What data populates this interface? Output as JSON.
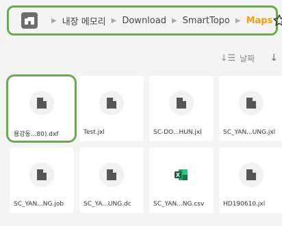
{
  "breadcrumb": {
    "items": [
      {
        "label": "내장 메모리"
      },
      {
        "label": "Download"
      },
      {
        "label": "SmartTopo"
      },
      {
        "label": "Maps"
      }
    ],
    "separator": "▶"
  },
  "sort": {
    "label": "날짜"
  },
  "files": [
    {
      "name": "용강동...80).dxf",
      "type": "generic"
    },
    {
      "name": "Test.jxl",
      "type": "generic"
    },
    {
      "name": "SC-DO...HUN.jxl",
      "type": "generic"
    },
    {
      "name": "SC_YAN...UNG.jxl",
      "type": "generic"
    },
    {
      "name": "SC_YAN...NG.job",
      "type": "generic"
    },
    {
      "name": "SC_YA...UNG.dc",
      "type": "generic"
    },
    {
      "name": "SC_YAN...NG.csv",
      "type": "excel"
    },
    {
      "name": "HD190610.jxl",
      "type": "generic"
    }
  ],
  "colors": {
    "accent": "#f39c12",
    "highlight": "#6aa84f",
    "excel": "#1d7a45"
  },
  "icons": {
    "home": "home-icon",
    "star": "star-icon",
    "sort": "sort-icon",
    "sort_direction": "arrow-down-icon",
    "file": "file-icon",
    "excel": "excel-icon"
  }
}
